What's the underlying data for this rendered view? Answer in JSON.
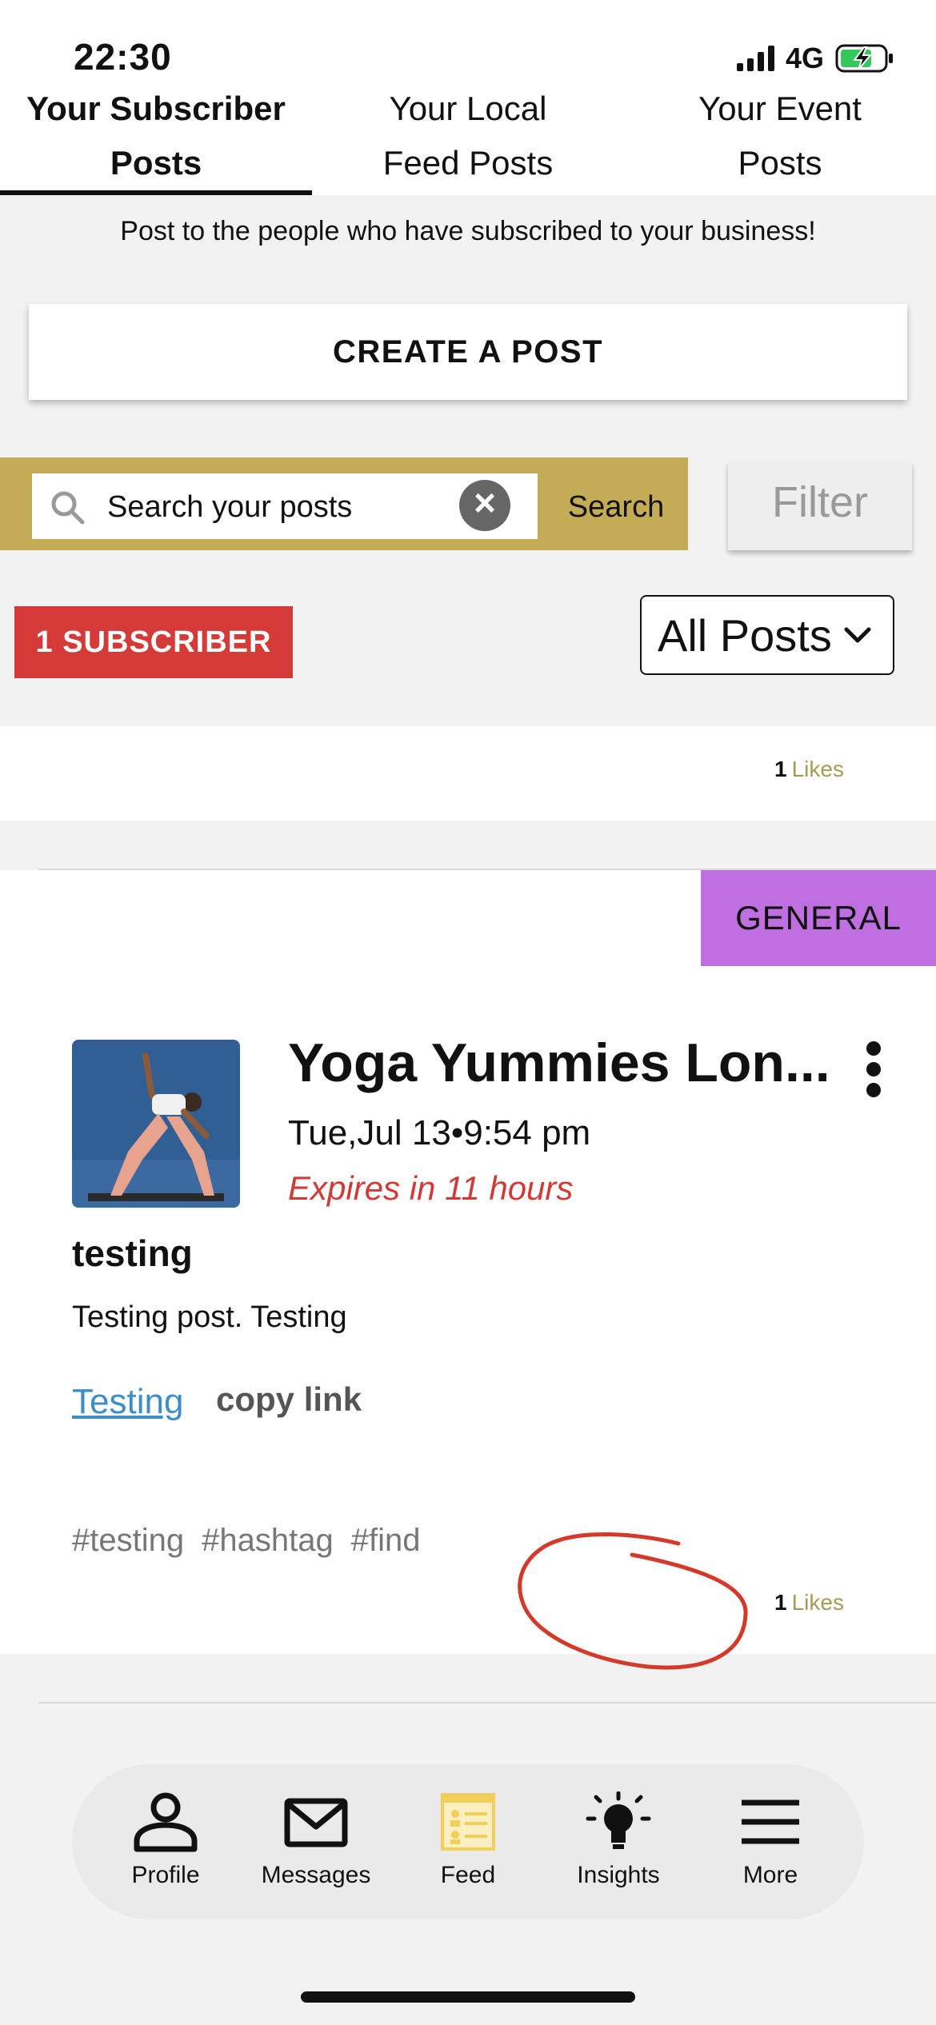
{
  "status_bar": {
    "time": "22:30",
    "network": "4G"
  },
  "tabs": [
    {
      "label_line1": "Your Subscriber",
      "label_line2": "Posts",
      "active": true
    },
    {
      "label_line1": "Your Local",
      "label_line2": "Feed Posts",
      "active": false
    },
    {
      "label_line1": "Your Event",
      "label_line2": "Posts",
      "active": false
    }
  ],
  "intro_text": "Post to the people who have subscribed to your business!",
  "create_post_label": "CREATE A POST",
  "search": {
    "placeholder": "Search your posts",
    "button_label": "Search",
    "filter_label": "Filter"
  },
  "subscriber_badge": "1 SUBSCRIBER",
  "posts_filter": {
    "selected": "All Posts"
  },
  "posts": [
    {
      "likes_count": "1",
      "likes_label": "Likes"
    },
    {
      "category": "GENERAL",
      "title": "Yoga Yummies Lon...",
      "date": "Tue,Jul 13•9:54 pm",
      "expires": "Expires in 11 hours",
      "heading": "testing",
      "body": "Testing post. Testing",
      "link_text": "Testing",
      "copy_link_label": "copy link",
      "hashtags": [
        "#testing",
        "#hashtag",
        "#find"
      ],
      "likes_count": "1",
      "likes_label": "Likes"
    }
  ],
  "bottom_nav": [
    {
      "label": "Profile",
      "icon": "person-icon"
    },
    {
      "label": "Messages",
      "icon": "envelope-icon"
    },
    {
      "label": "Feed",
      "icon": "feed-icon",
      "active": true
    },
    {
      "label": "Insights",
      "icon": "lightbulb-icon"
    },
    {
      "label": "More",
      "icon": "hamburger-icon"
    }
  ],
  "colors": {
    "search_strip": "#c4ac54",
    "subscriber_badge": "#d43a37",
    "general_badge": "#c06fe0",
    "expires_text": "#d23a35",
    "link": "#3b8ec8",
    "likes": "#a79a57",
    "feed_icon": "#f2cf5b"
  }
}
